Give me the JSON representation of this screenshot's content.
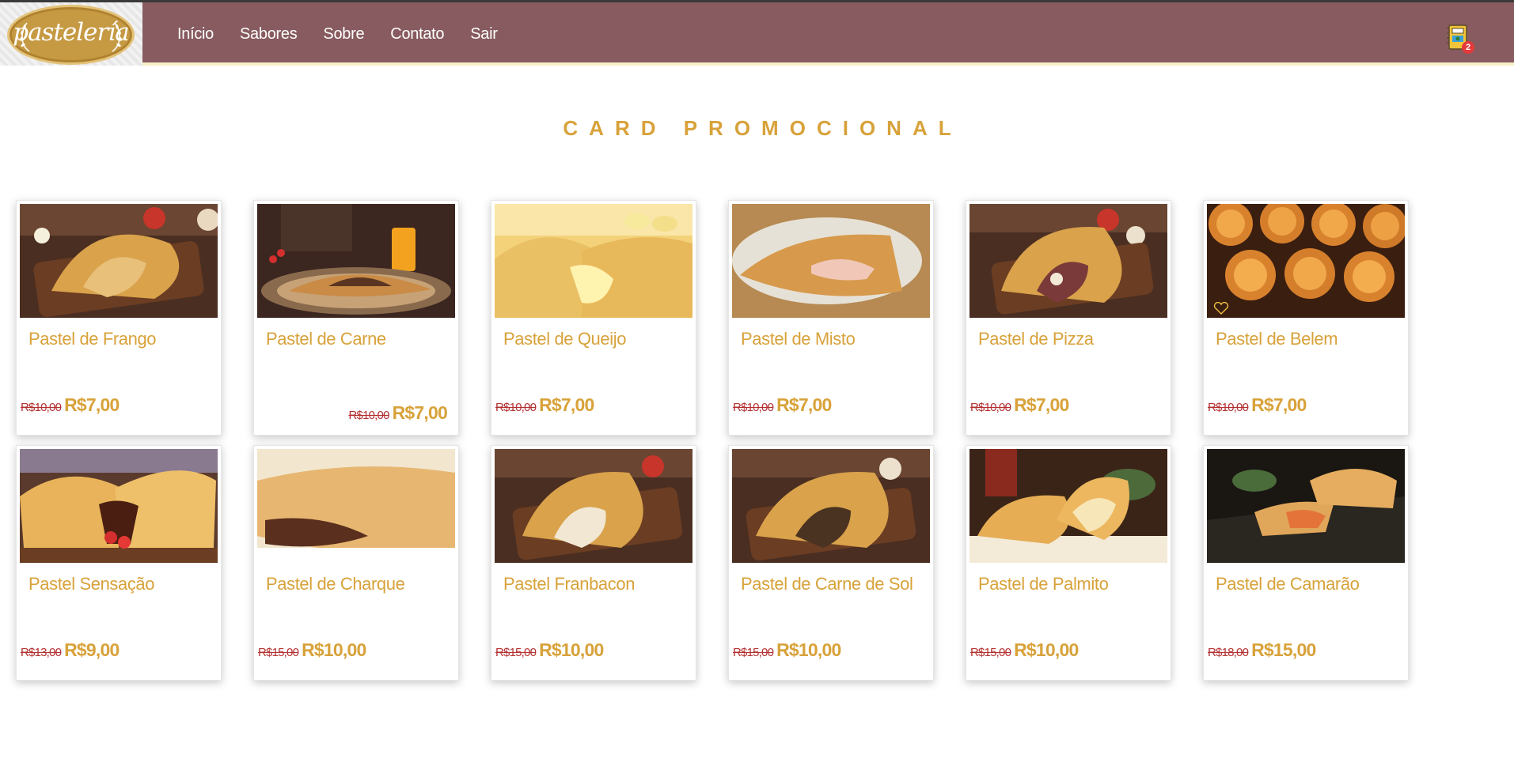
{
  "brand": {
    "logo_text": "pastelería"
  },
  "nav": [
    "Início",
    "Sabores",
    "Sobre",
    "Contato",
    "Sair"
  ],
  "cart": {
    "icon": "cart-icon",
    "count": "2"
  },
  "section_title": "CARD PROMOCIONAL",
  "colors": {
    "header": "#875b5f",
    "accent": "#d8a23a",
    "old_price": "#b43131"
  },
  "products": [
    {
      "name": "Pastel de Frango",
      "old_price": "R$10,00",
      "price": "R$7,00"
    },
    {
      "name": "Pastel de Carne",
      "old_price": "R$10,00",
      "price": "R$7,00"
    },
    {
      "name": "Pastel de Queijo",
      "old_price": "R$10,00",
      "price": "R$7,00"
    },
    {
      "name": "Pastel de Misto",
      "old_price": "R$10,00",
      "price": "R$7,00"
    },
    {
      "name": "Pastel de Pizza",
      "old_price": "R$10,00",
      "price": "R$7,00"
    },
    {
      "name": "Pastel de Belem",
      "old_price": "R$10,00",
      "price": "R$7,00"
    },
    {
      "name": "Pastel Sensação",
      "old_price": "R$13,00",
      "price": "R$9,00"
    },
    {
      "name": "Pastel de Charque",
      "old_price": "R$15,00",
      "price": "R$10,00"
    },
    {
      "name": "Pastel Franbacon",
      "old_price": "R$15,00",
      "price": "R$10,00"
    },
    {
      "name": "Pastel de Carne de Sol",
      "old_price": "R$15,00",
      "price": "R$10,00"
    },
    {
      "name": "Pastel de Palmito",
      "old_price": "R$15,00",
      "price": "R$10,00"
    },
    {
      "name": "Pastel de Camarão",
      "old_price": "R$18,00",
      "price": "R$15,00"
    }
  ]
}
